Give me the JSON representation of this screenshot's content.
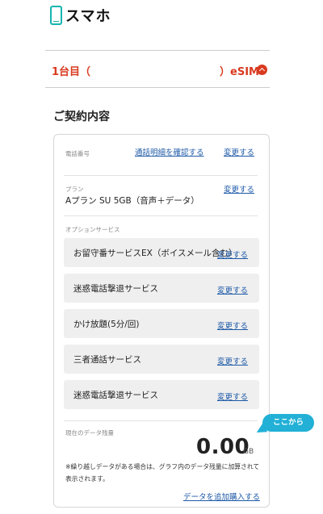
{
  "header": {
    "title": "スマホ",
    "icon": "smartphone-icon",
    "accent": "#16b4b0"
  },
  "line": {
    "label": "1台目（",
    "close_paren": "）",
    "type": "eSIM",
    "accent": "#d93a1f",
    "toggle_icon": "chevron-up-icon"
  },
  "contract": {
    "section_title": "ご契約内容",
    "phone": {
      "label": "電話番号",
      "detail_link": "通話明細を確認する",
      "change_link": "変更する"
    },
    "plan": {
      "label": "プラン",
      "value": "Aプラン SU 5GB（音声＋データ）",
      "change_link": "変更する"
    },
    "options": {
      "label": "オプションサービス",
      "items": [
        {
          "name": "お留守番サービスEX（ボイスメール含む）",
          "change_link": "変更する"
        },
        {
          "name": "迷惑電話撃退サービス",
          "change_link": "変更する"
        },
        {
          "name": "かけ放題(5分/回)",
          "change_link": "変更する"
        },
        {
          "name": "三者通話サービス",
          "change_link": "変更する"
        },
        {
          "name": "迷惑電話撃退サービス",
          "change_link": "変更する"
        }
      ]
    },
    "data": {
      "label": "現在のデータ残量",
      "value": "0.00",
      "unit": "GB",
      "callout": "ここから",
      "callout_color": "#22b0d6",
      "note": "※繰り越しデータがある場合は、グラフ内のデータ残量に加算されて表示されます。",
      "buy_link": "データを追加購入する"
    }
  }
}
